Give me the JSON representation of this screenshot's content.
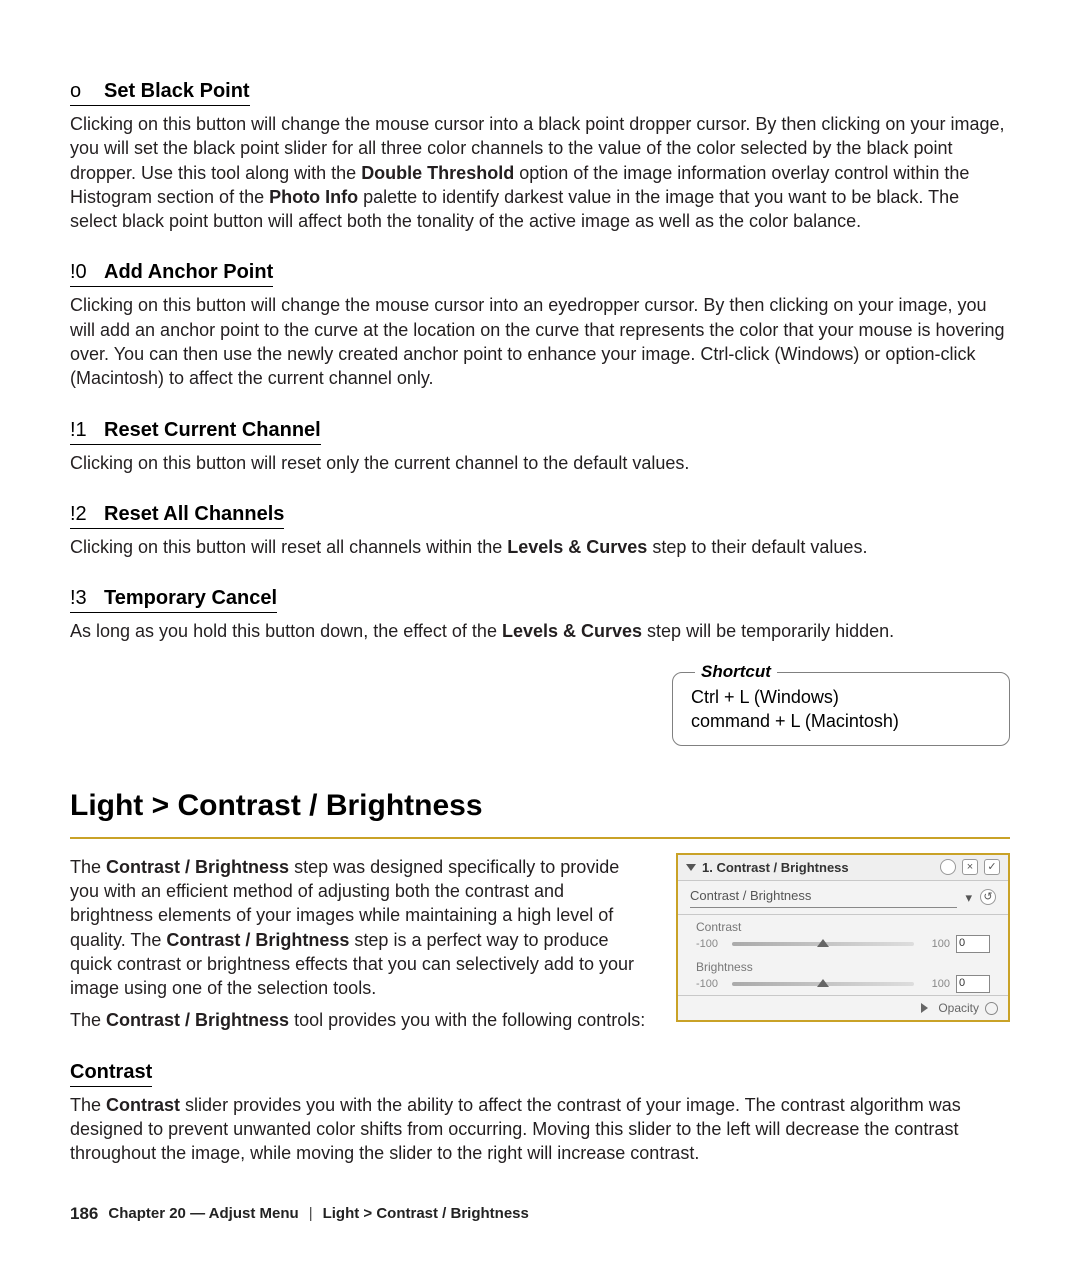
{
  "sections": {
    "black": {
      "bullet": "o",
      "title": "Set Black Point",
      "body_pre": "Clicking on this button will change the mouse cursor into a black point dropper cursor. By then clicking on your image, you will set the black point slider for all three color channels to the value of the color selected by the black point dropper. Use this tool along with the ",
      "body_bold1": "Double Threshold",
      "body_mid": " option of the image information overlay control within the Histogram section of the ",
      "body_bold2": "Photo Info",
      "body_post": " palette to identify darkest value in the image that you want to be black. The select black point button will affect both the tonality of the active image as well as the color balance."
    },
    "anchor": {
      "bullet": "!0",
      "title": "Add Anchor Point",
      "body": "Clicking on this button will change the mouse cursor into an eyedropper cursor. By then clicking on your image, you will add an anchor point to the curve at the location on the curve that represents the color that your mouse is hovering over. You can then use the newly created anchor point to enhance your image. Ctrl-click (Windows) or option-click (Macintosh) to affect the current channel only."
    },
    "reset_cur": {
      "bullet": "!1",
      "title": "Reset Current Channel",
      "body": "Clicking on this button will reset only the current channel to the default values."
    },
    "reset_all": {
      "bullet": "!2",
      "title": "Reset All Channels",
      "body_pre": "Clicking on this button will reset all channels within the ",
      "body_bold": "Levels & Curves",
      "body_post": " step to their default values."
    },
    "temp": {
      "bullet": "!3",
      "title": "Temporary Cancel",
      "body_pre": "As long as you hold this button down, the effect of the ",
      "body_bold": "Levels & Curves",
      "body_post": " step will be temporarily hidden."
    }
  },
  "shortcut": {
    "legend": "Shortcut",
    "line1": "Ctrl + L (Windows)",
    "line2": "command + L (Macintosh)"
  },
  "heading": "Light > Contrast / Brightness",
  "cb": {
    "p1_pre": "The ",
    "p1_b1": "Contrast / Brightness",
    "p1_mid1": " step was designed specifically to provide you with an efficient method of adjusting both the contrast and brightness elements of your images while maintaining a high level of quality. The ",
    "p1_b2": "Contrast / Brightness",
    "p1_post": " step is a perfect way to produce quick contrast or brightness effects that you can selectively add to your image using one of the selection tools.",
    "p2_pre": "The ",
    "p2_b": "Contrast / Brightness",
    "p2_post": " tool provides you with the following controls:"
  },
  "contrast": {
    "title": "Contrast",
    "body_pre": "The ",
    "body_b": "Contrast",
    "body_post": " slider provides you with the ability to affect the contrast of your image. The contrast algorithm was designed to prevent unwanted color shifts from occurring. Moving this slider to the left will decrease the contrast throughout the image, while moving the slider to the right will increase contrast."
  },
  "panel": {
    "title": "1. Contrast / Brightness",
    "method": "Contrast / Brightness",
    "sliders": {
      "contrast": {
        "label": "Contrast",
        "min": "-100",
        "max": "100",
        "value": "0"
      },
      "brightness": {
        "label": "Brightness",
        "min": "-100",
        "max": "100",
        "value": "0"
      }
    },
    "opacity": "Opacity",
    "icons": {
      "help": "?",
      "close": "×",
      "check": "✓",
      "dropdown": "▾"
    }
  },
  "footer": {
    "page": "186",
    "chapter": "Chapter 20 — Adjust Menu",
    "sep": "|",
    "crumb": "Light > Contrast / Brightness"
  }
}
